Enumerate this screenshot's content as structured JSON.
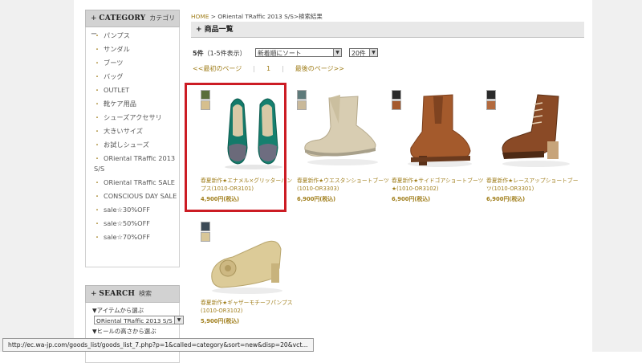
{
  "sidebar": {
    "category_title_en": "CATEGORY",
    "category_title_jp": "カテゴリー",
    "categories": [
      "パンプス",
      "サンダル",
      "ブーツ",
      "バッグ",
      "OUTLET",
      "靴ケア用品",
      "シューズアクセサリ",
      "大きいサイズ",
      "お試しシューズ",
      "ORiental TRaffic 2013 S/S",
      "ORiental TRaffic SALE",
      "CONSCIOUS DAY SALE",
      "sale☆30%OFF",
      "sale☆50%OFF",
      "sale☆70%OFF"
    ],
    "search_title_en": "SEARCH",
    "search_title_jp": "検索",
    "item_label": "▼アイテムから選ぶ",
    "item_value": "ORiental TRaffic 2013 S/S",
    "heel_label": "▼ヒールの高さから選ぶ"
  },
  "breadcrumb": {
    "home": "HOME",
    "rest": " > ORiental TRaffic 2013 S/S>検索結果"
  },
  "title": "+ 商品一覧",
  "controls": {
    "count": "5件",
    "range": "（1-5件表示）",
    "sort_value": "新着順にソート",
    "per_page_value": "20件"
  },
  "pager": {
    "first": "<<最初のページ",
    "page": "1",
    "last": "最後のページ>>"
  },
  "products": [
    {
      "name": "春夏新作★エナメル×グリッターパンプス(1010-OR3101)",
      "price": "4,900円(税込)",
      "swatches": [
        "#5a6e3c",
        "#d6bf8e"
      ]
    },
    {
      "name": "春夏新作★ウエスタンショートブーツ(1010-OR3303)",
      "price": "6,900円(税込)",
      "swatches": [
        "#5e7a7a",
        "#c9b99a"
      ]
    },
    {
      "name": "春夏新作★サイドゴアショートブーツ★(1010-OR3102)",
      "price": "6,900円(税込)",
      "swatches": [
        "#2a2a2a",
        "#a55a2e"
      ]
    },
    {
      "name": "春夏新作★レースアップショートブーツ(1010-OR3301)",
      "price": "6,900円(税込)",
      "swatches": [
        "#2a2a2a",
        "#b36a3e"
      ]
    },
    {
      "name": "春夏新作★ギャザーモチーフパンプス(1010-OR3102)",
      "price": "5,900円(税込)",
      "swatches": [
        "#3c4a56",
        "#d8c698"
      ]
    }
  ],
  "status_url": "http://ec.wa-jp.com/goods_list/goods_list_7.php?p=1&called=category&sort=new&disp=20&vct...",
  "colors": {
    "accent": "#a07e1b",
    "highlight": "#cc1c24"
  }
}
